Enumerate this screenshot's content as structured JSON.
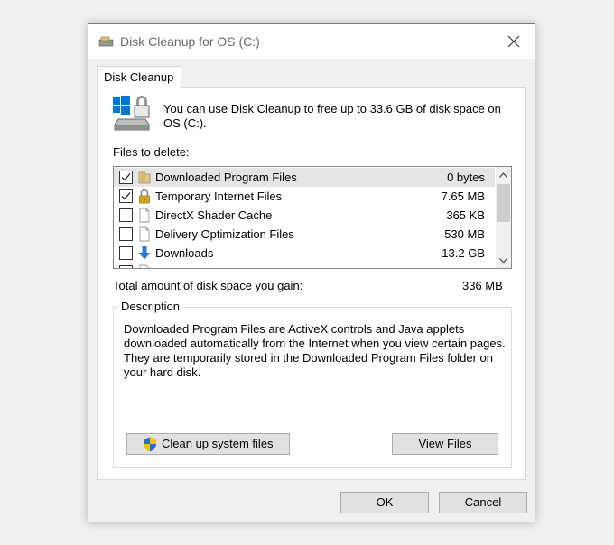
{
  "window": {
    "title": "Disk Cleanup for OS (C:)"
  },
  "tab": {
    "label": "Disk Cleanup"
  },
  "intro_text": "You can use Disk Cleanup to free up to 33.6 GB of disk space on OS (C:).",
  "files_label": "Files to delete:",
  "files": [
    {
      "name": "Downloaded Program Files",
      "size": "0 bytes",
      "checked": true,
      "selected": true,
      "icon": "folder-icon"
    },
    {
      "name": "Temporary Internet Files",
      "size": "7.65 MB",
      "checked": true,
      "selected": false,
      "icon": "lock-icon"
    },
    {
      "name": "DirectX Shader Cache",
      "size": "365 KB",
      "checked": false,
      "selected": false,
      "icon": "file-icon"
    },
    {
      "name": "Delivery Optimization Files",
      "size": "530 MB",
      "checked": false,
      "selected": false,
      "icon": "file-icon"
    },
    {
      "name": "Downloads",
      "size": "13.2 GB",
      "checked": false,
      "selected": false,
      "icon": "download-arrow-icon"
    }
  ],
  "total": {
    "label": "Total amount of disk space you gain:",
    "value": "336 MB"
  },
  "description": {
    "legend": "Description",
    "text": "Downloaded Program Files are ActiveX controls and Java applets downloaded automatically from the Internet when you view certain pages. They are temporarily stored in the Downloaded Program Files folder on your hard disk."
  },
  "buttons": {
    "cleanup": "Clean up system files",
    "view_files": "View Files",
    "ok": "OK",
    "cancel": "Cancel"
  },
  "colors": {
    "accent_blue": "#0078d7",
    "folder_tan": "#dcc68a",
    "lock_gold": "#d9a520"
  }
}
